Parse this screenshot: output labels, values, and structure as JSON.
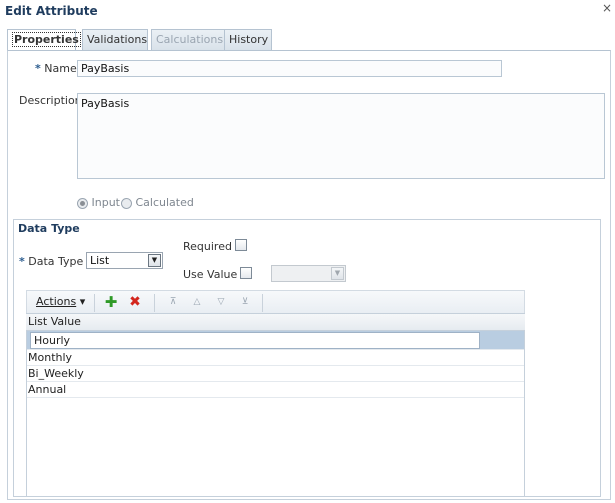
{
  "dialog": {
    "title": "Edit Attribute",
    "close_glyph": "×"
  },
  "tabs": [
    {
      "label": "Properties",
      "state": "active"
    },
    {
      "label": "Validations",
      "state": "normal"
    },
    {
      "label": "Calculations",
      "state": "disabled"
    },
    {
      "label": "History",
      "state": "normal"
    }
  ],
  "properties": {
    "required_marker": "*",
    "name_label": "Name",
    "name_value": "PayBasis",
    "description_label": "Description",
    "description_value": "PayBasis",
    "radio_input_label": "Input",
    "radio_calculated_label": "Calculated",
    "radio_selected": "Input"
  },
  "data_type": {
    "section_title": "Data Type",
    "required_marker": "*",
    "data_type_label": "Data Type",
    "data_type_value": "List",
    "required_label": "Required",
    "required_checked": false,
    "use_value_label": "Use Value",
    "use_value_checked": false,
    "use_value_select": ""
  },
  "toolbar": {
    "actions_label": "Actions",
    "actions_arrow": "▾",
    "add_glyph": "✚",
    "delete_glyph": "✖",
    "move_top_glyph": "⊼",
    "move_up_glyph": "△",
    "move_down_glyph": "▽",
    "move_bottom_glyph": "⊻"
  },
  "list_table": {
    "column_header": "List Value",
    "rows": [
      "Hourly",
      "Monthly",
      "Bi_Weekly",
      "Annual"
    ],
    "selected_index": 0
  },
  "colors": {
    "title": "#1f3c5e",
    "selected_row": "#b9cde1",
    "add_icon": "#2f9a27",
    "delete_icon": "#d3261d"
  }
}
